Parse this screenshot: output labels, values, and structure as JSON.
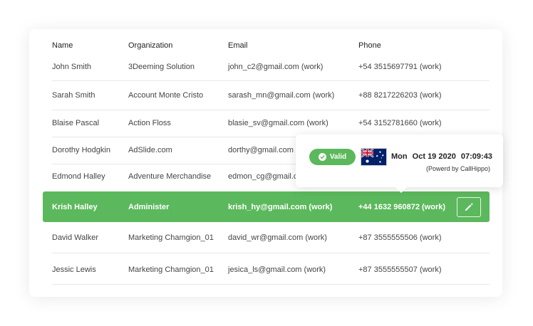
{
  "table": {
    "headers": {
      "name": "Name",
      "organization": "Organization",
      "email": "Email",
      "phone": "Phone"
    },
    "rows": [
      {
        "name": "John Smith",
        "organization": "3Deeming Solution",
        "email": "john_c2@gmail.com (work)",
        "phone": "+54 3515697791 (work)"
      },
      {
        "name": "Sarah Smith",
        "organization": "Account Monte Cristo",
        "email": "sarash_mn@gmail.com (work)",
        "phone": "+88 8217226203 (work)"
      },
      {
        "name": "Blaise Pascal",
        "organization": "Action Floss",
        "email": "blasie_sv@gmail.com (work)",
        "phone": "+54 3152781660 (work)"
      },
      {
        "name": "Dorothy Hodgkin",
        "organization": "AdSlide.com",
        "email": "dorthy@gmail.com (",
        "phone": ""
      },
      {
        "name": "Edmond Halley",
        "organization": "Adventure Merchandise",
        "email": "edmon_cg@gmail.co",
        "phone": ""
      },
      {
        "name": "Krish Halley",
        "organization": "Administer",
        "email": "krish_hy@gmail.com (work)",
        "phone": "+44 1632 960872 (work)"
      },
      {
        "name": "David Walker",
        "organization": "Marketing Chamgion_01",
        "email": "david_wr@gmail.com (work)",
        "phone": "+87 3555555506 (work)"
      },
      {
        "name": "Jessic Lewis",
        "organization": "Marketing Chamgion_01",
        "email": "jesica_ls@gmail.com (work)",
        "phone": "+87 3555555507 (work)"
      }
    ]
  },
  "tooltip": {
    "status": "Valid",
    "flag_icon": "australia-flag-icon",
    "day": "Mon",
    "date": "Oct 19 2020",
    "time": "07:09:43",
    "powered_by": "(Powerd by CallHippo)"
  },
  "colors": {
    "accent_green": "#5cb85c",
    "text": "#444444"
  }
}
